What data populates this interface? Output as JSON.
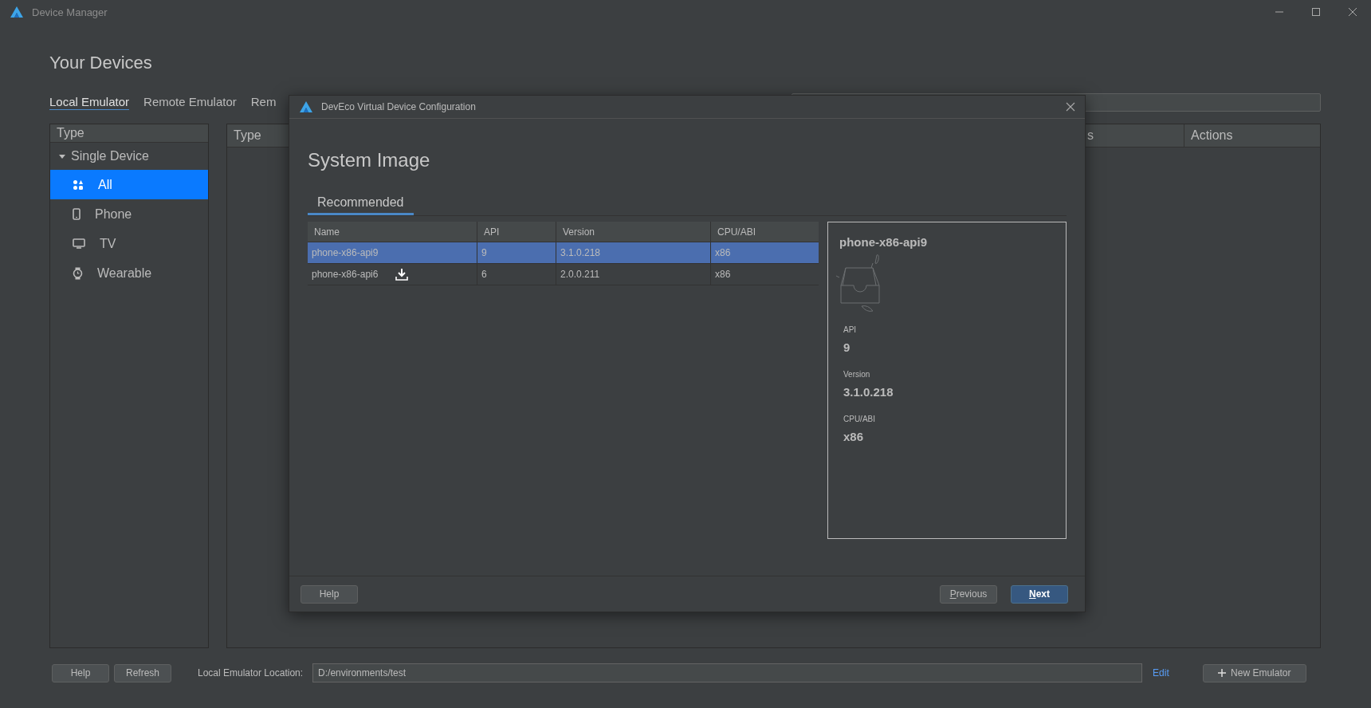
{
  "window": {
    "title": "Device Manager"
  },
  "heading": "Your Devices",
  "tabs": [
    {
      "label": "Local Emulator",
      "selected": true
    },
    {
      "label": "Remote Emulator",
      "selected": false
    },
    {
      "label": "Rem",
      "selected": false
    }
  ],
  "sidebar": {
    "header": "Type",
    "group": {
      "label": "Single Device",
      "expanded": true,
      "items": [
        {
          "label": "All",
          "kind": "all",
          "selected": true
        },
        {
          "label": "Phone",
          "kind": "phone",
          "selected": false
        },
        {
          "label": "TV",
          "kind": "tv",
          "selected": false
        },
        {
          "label": "Wearable",
          "kind": "watch",
          "selected": false
        }
      ]
    }
  },
  "device_table": {
    "columns": [
      "Type",
      "s",
      "Actions"
    ]
  },
  "footer": {
    "buttons": [
      "Help",
      "Refresh"
    ],
    "location_label": "Local Emulator Location:",
    "location_value": "D:/environments/test",
    "edit_link": "Edit",
    "new_button": "New Emulator"
  },
  "dialog": {
    "title": "DevEco Virtual Device Configuration",
    "heading": "System Image",
    "tabs": [
      {
        "label": "Recommended",
        "selected": true
      }
    ],
    "table": {
      "columns": [
        "Name",
        "API",
        "Version",
        "CPU/ABI"
      ],
      "rows": [
        {
          "cells": [
            "phone-x86-api9",
            "9",
            "3.1.0.218",
            "x86"
          ],
          "download": false,
          "selected": true
        },
        {
          "cells": [
            "phone-x86-api6",
            "6",
            "2.0.0.211",
            "x86"
          ],
          "download": true,
          "selected": false
        }
      ]
    },
    "details": {
      "title": "phone-x86-api9",
      "fields": [
        {
          "label": "API",
          "value": "9"
        },
        {
          "label": "Version",
          "value": "3.1.0.218"
        },
        {
          "label": "CPU/ABI",
          "value": "x86"
        }
      ]
    },
    "buttons": [
      {
        "label": "Help",
        "kind": "help",
        "mnemonic": false,
        "default": false
      },
      {
        "label": "Previous",
        "kind": "nav",
        "mnemonic": true,
        "default": false
      },
      {
        "label": "Next",
        "kind": "nav",
        "mnemonic": true,
        "default": true
      }
    ]
  }
}
